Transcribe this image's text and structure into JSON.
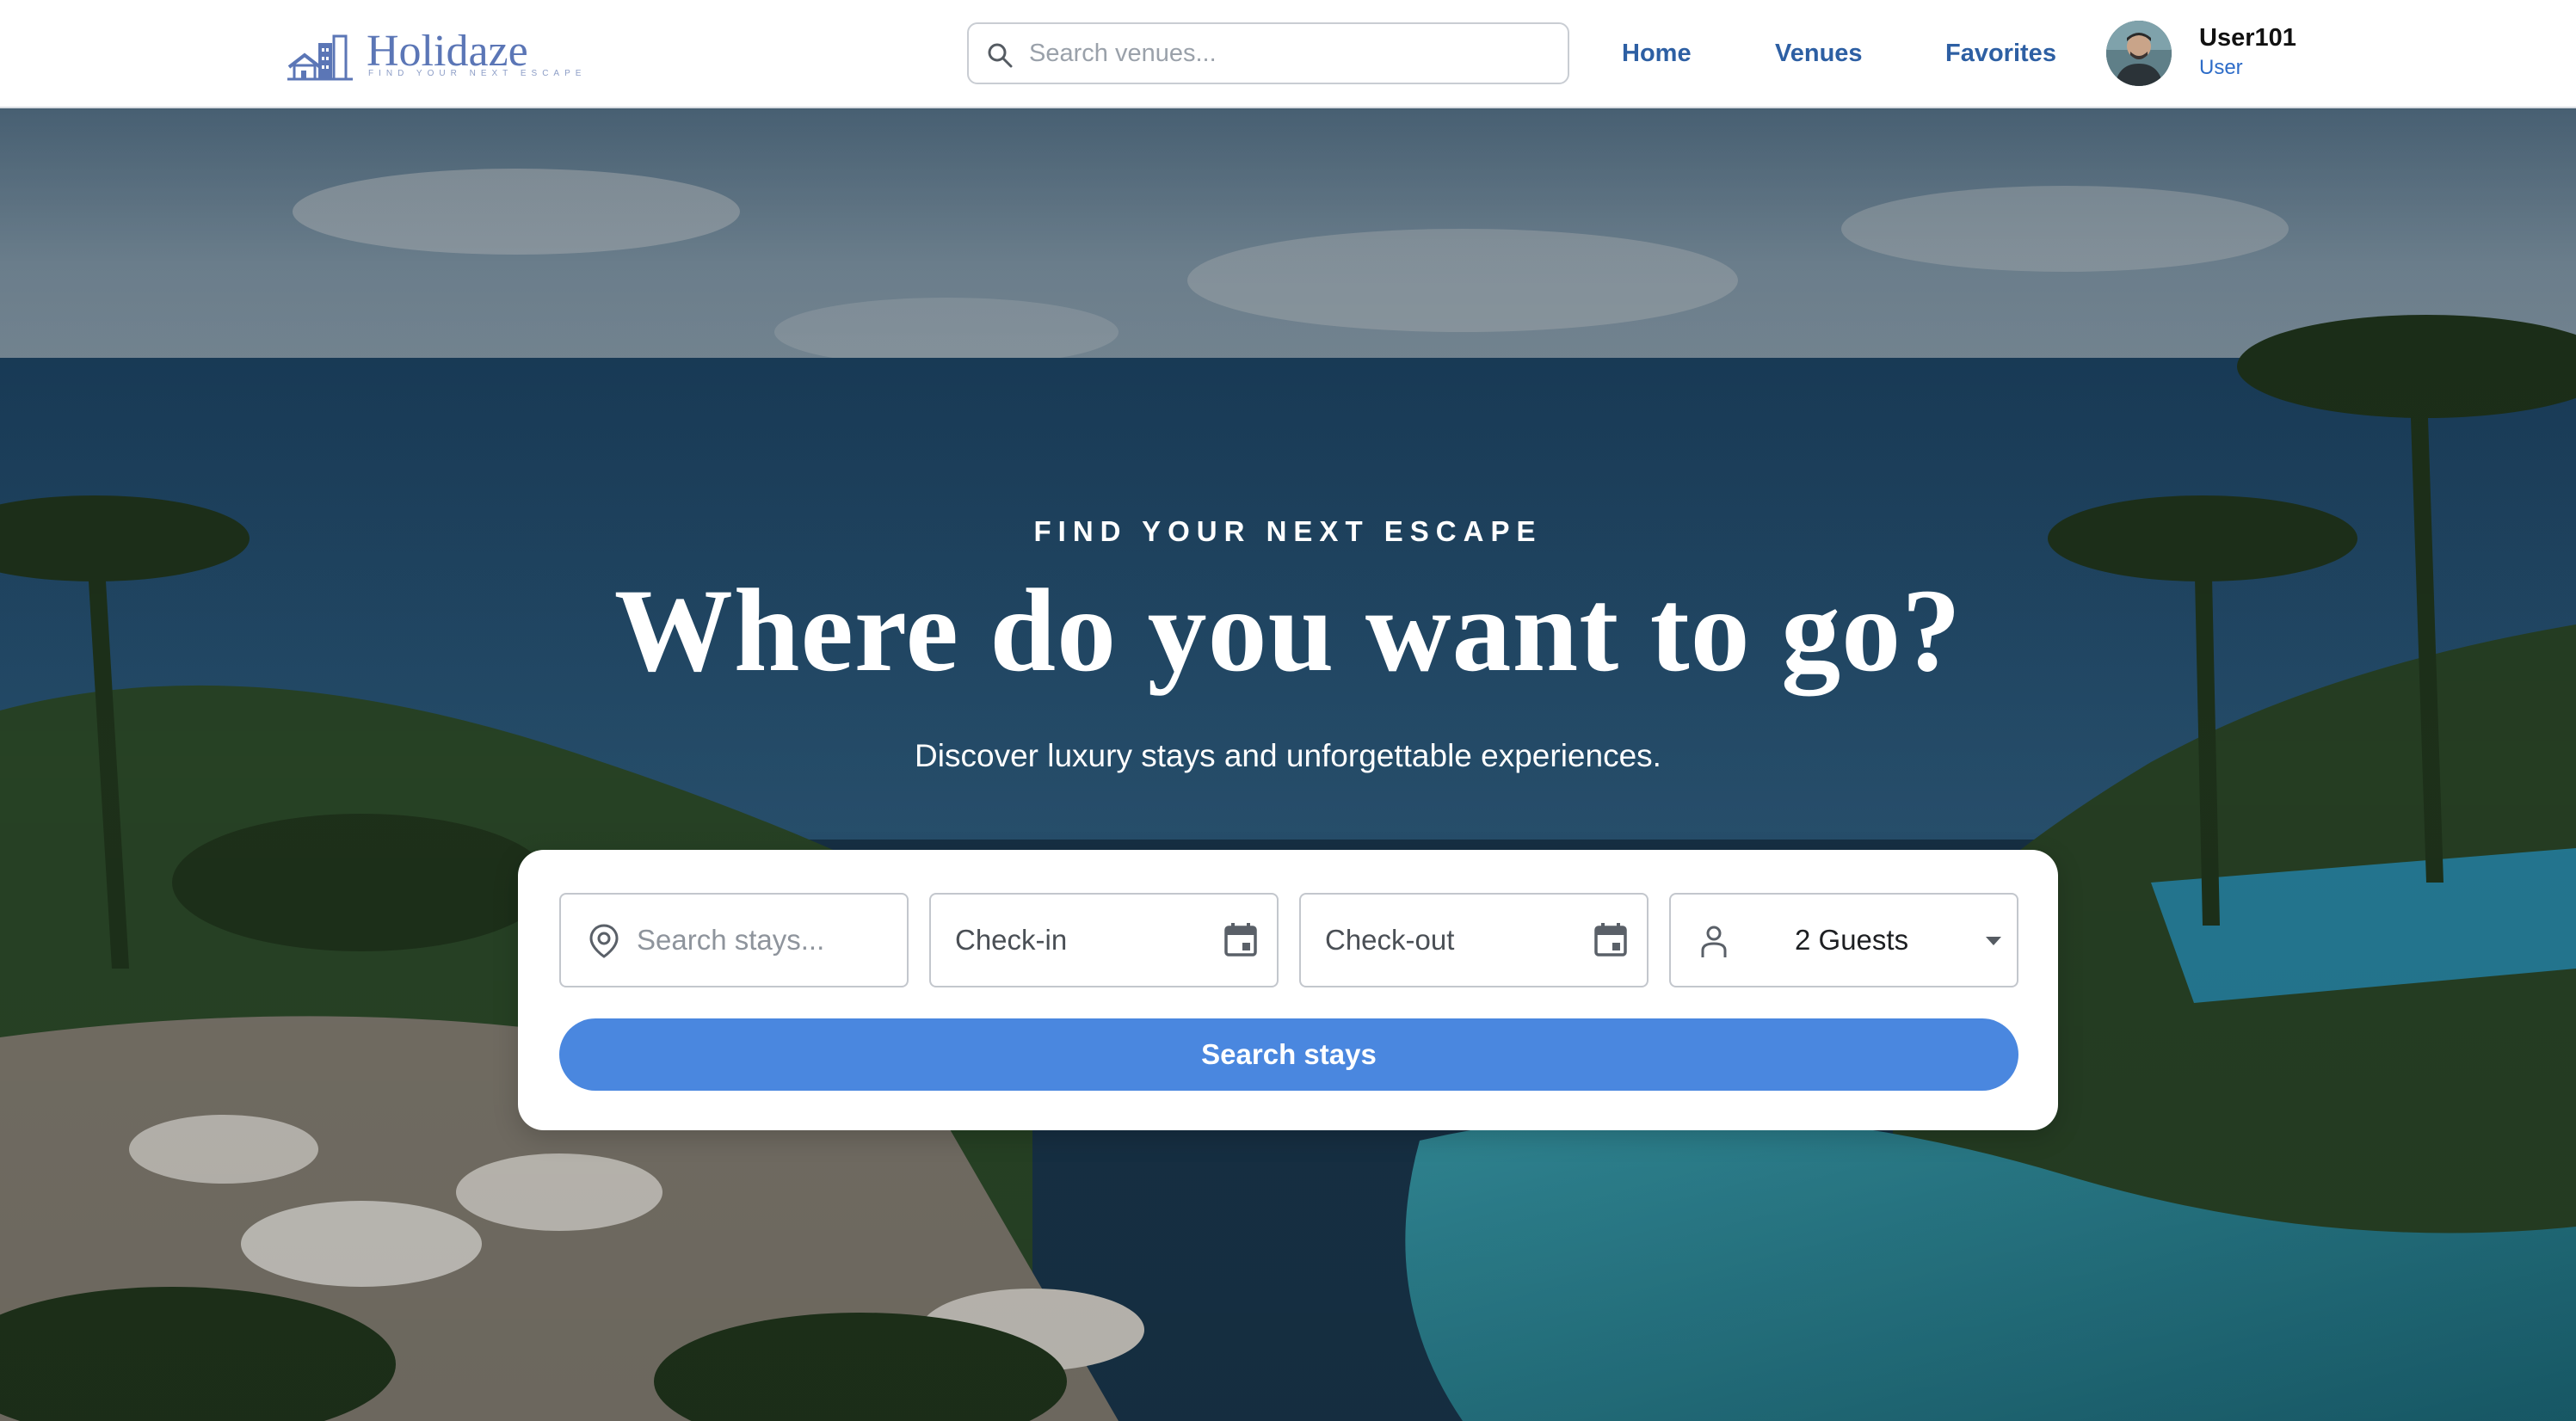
{
  "header": {
    "logo": {
      "name": "Holidaze",
      "tagline": "FIND YOUR NEXT ESCAPE"
    },
    "search": {
      "placeholder": "Search venues...",
      "value": ""
    },
    "nav": [
      {
        "label": "Home"
      },
      {
        "label": "Venues"
      },
      {
        "label": "Favorites"
      }
    ],
    "user": {
      "name": "User101",
      "role": "User"
    }
  },
  "hero": {
    "eyebrow": "FIND YOUR NEXT ESCAPE",
    "headline": "Where do you want to go?",
    "subhead": "Discover luxury stays and unforgettable experiences."
  },
  "search_card": {
    "stays": {
      "placeholder": "Search stays...",
      "value": "",
      "icon": "location-pin-icon"
    },
    "checkin": {
      "placeholder": "Check-in",
      "value": "",
      "icon": "calendar-icon"
    },
    "checkout": {
      "placeholder": "Check-out",
      "value": "",
      "icon": "calendar-icon"
    },
    "guests": {
      "value": "2 Guests",
      "icon": "person-icon"
    },
    "button_label": "Search stays"
  },
  "colors": {
    "brand": "#5b76b6",
    "nav_link": "#2d5fa3",
    "primary_button": "#4a87df",
    "user_role": "#2d6cc8"
  }
}
